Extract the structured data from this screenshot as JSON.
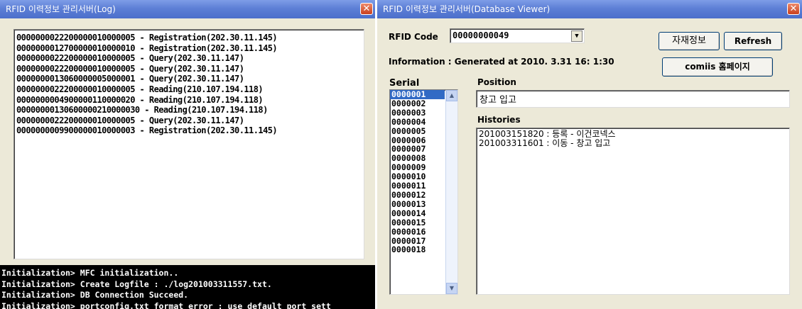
{
  "log_window": {
    "title": "RFID 이력정보 관리서버(Log)",
    "log_entries": [
      "000000002220000001000000 5 - Registration(202.30.11.145)",
      "000000001270000001000001 0 - Registration(202.30.11.145)",
      "000000002220000001000000 5 - Query(202.30.11.147)",
      "000000002220000001000000 5 - Query(202.30.11.147)",
      "000000001306000000500000 1 - Query(202.30.11.147)",
      "000000002220000001000000 5 - Reading(210.107.194.118)",
      "000000000490000011000002 0 - Reading(210.107.194.118)",
      "000000001306000002100000 30 - Reading(210.107.194.118)",
      "000000002220000001000000 5 - Query(202.30.11.147)",
      "000000000990000001000000 3 - Registration(202.30.11.145)"
    ],
    "console_lines": [
      "Initialization> MFC initialization..",
      "Initialization> Create Logfile : ./log201003311557.txt.",
      "Initialization> DB Connection Succeed.",
      "Initialization> portconfig.txt format error : use default port sett"
    ]
  },
  "db_window": {
    "title": "RFID 이력정보 관리서버(Database Viewer)",
    "rfid_code_label": "RFID Code",
    "rfid_code_value": "00000000049",
    "information_text": "Information : Generated at 2010. 3.31 16: 1:30",
    "material_info_button": "자재정보",
    "refresh_button": "Refresh",
    "homepage_button": "comiis 홈페이지",
    "serial_label": "Serial",
    "position_label": "Position",
    "position_value": "창고 입고",
    "histories_label": "Histories",
    "serials": [
      "0000001",
      "0000002",
      "0000003",
      "0000004",
      "0000005",
      "0000006",
      "0000007",
      "0000008",
      "0000009",
      "0000010",
      "0000011",
      "0000012",
      "0000013",
      "0000014",
      "0000015",
      "0000016",
      "0000017",
      "0000018"
    ],
    "selected_serial": "0000001",
    "histories": [
      "201003151820 : 등록 - 이건코넥스",
      "201003311601 : 이동 - 창고 입고"
    ]
  }
}
